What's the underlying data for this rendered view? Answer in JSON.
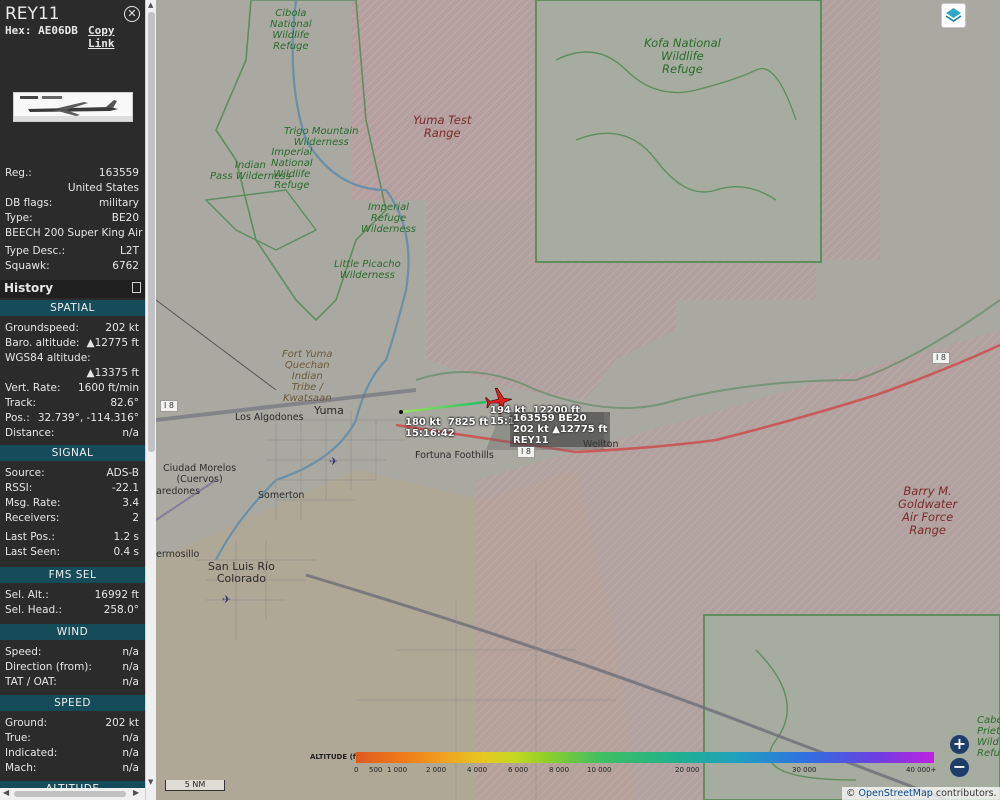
{
  "panel": {
    "callsign": "REY11",
    "hex_line": "Hex: AE06DB",
    "copy_link": "Copy Link",
    "info": [
      {
        "k": "Reg.:",
        "v": "163559"
      },
      {
        "k": "",
        "v": "United States"
      },
      {
        "k": "DB flags:",
        "v": "military"
      },
      {
        "k": "Type:",
        "v": "BE20"
      },
      {
        "k": "BEECH 200 Super King Air",
        "v": ""
      },
      {
        "k": "Type Desc.:",
        "v": "L2T"
      },
      {
        "k": "Squawk:",
        "v": "6762"
      }
    ],
    "history_label": "History",
    "sections": {
      "spatial": "SPATIAL",
      "signal": "SIGNAL",
      "fms": "FMS SEL",
      "wind": "WIND",
      "speed": "SPEED",
      "altitude": "ALTITUDE"
    },
    "spatial": [
      {
        "k": "Groundspeed:",
        "v": "202 kt"
      },
      {
        "k": "Baro. altitude:",
        "v": "▲12775 ft"
      },
      {
        "k": "WGS84 altitude:",
        "v": ""
      },
      {
        "k": "",
        "v": "▲13375 ft"
      },
      {
        "k": "Vert. Rate:",
        "v": "1600 ft/min"
      },
      {
        "k": "Track:",
        "v": "82.6°"
      },
      {
        "k": "Pos.:",
        "v": "32.739°, -114.316°"
      },
      {
        "k": "Distance:",
        "v": "n/a"
      }
    ],
    "signal": [
      {
        "k": "Source:",
        "v": "ADS-B"
      },
      {
        "k": "RSSI:",
        "v": "-22.1"
      },
      {
        "k": "Msg. Rate:",
        "v": "3.4"
      },
      {
        "k": "Receivers:",
        "v": "2"
      },
      {
        "k": "Last Pos.:",
        "v": "1.2 s"
      },
      {
        "k": "Last Seen:",
        "v": "0.4 s"
      }
    ],
    "fms": [
      {
        "k": "Sel. Alt.:",
        "v": "16992 ft"
      },
      {
        "k": "Sel. Head.:",
        "v": "258.0°"
      }
    ],
    "wind": [
      {
        "k": "Speed:",
        "v": "n/a"
      },
      {
        "k": "Direction (from):",
        "v": "n/a"
      },
      {
        "k": "TAT / OAT:",
        "v": "n/a"
      }
    ],
    "speed": [
      {
        "k": "Ground:",
        "v": "202 kt"
      },
      {
        "k": "True:",
        "v": "n/a"
      },
      {
        "k": "Indicated:",
        "v": "n/a"
      },
      {
        "k": "Mach:",
        "v": "n/a"
      }
    ]
  },
  "map": {
    "labels": {
      "cibola": "Cibola\nNational\nWildlife\nRefuge",
      "kofa": "Kofa National\nWildlife\nRefuge",
      "yuma_test": "Yuma Test\nRange",
      "trigo": "Trigo Mountain\nWilderness",
      "imperial_nwr": "Imperial\nNational\nWildlife\nRefuge",
      "indian_pass": "Indian\nPass Wilderness",
      "imperial_refuge": "Imperial\nRefuge\nWilderness",
      "little_picacho": "Little Picacho\nWilderness",
      "fort_yuma": "Fort Yuma\nQuechan\nIndian\nTribe /\nKwatsaan",
      "barry": "Barry M.\nGoldwater\nAir Force\nRange",
      "cabeza": "Cabe\nPrieta N\nWild\nRefu"
    },
    "cities": {
      "yuma": "Yuma",
      "los_algodones": "Los Algodones",
      "fortuna": "Fortuna Foothills",
      "wellton": "Wellton",
      "ciudad_morelos": "Ciudad Morelos\n(Cuervos)",
      "paredones": "aredones",
      "somerton": "Somerton",
      "hermosillo": "ermosillo",
      "san_luis": "San Luis Río\nColorado"
    },
    "shields": [
      "I 8",
      "I 8",
      "I 8"
    ],
    "aircraft": {
      "track_label_1": "180 kt  7825 ft\n15:16:42",
      "track_label_2": "194 kt  12200 ft\n15:1",
      "info_box": "163559 BE20\n202 kt ▲12775 ft\nREY11"
    },
    "scale": "5 NM",
    "attribution_prefix": "© ",
    "attribution_link": "OpenStreetMap",
    "attribution_suffix": " contributors.",
    "legend": {
      "title": "ALTITUDE (ft)",
      "ticks": [
        "0",
        "500",
        "1 000",
        "2 000",
        "4 000",
        "6 000",
        "8 000",
        "10 000",
        "20 000",
        "30 000",
        "40 000+"
      ]
    },
    "colors": {
      "restricted_fill": "#b89a9a",
      "refuge_border": "#5e8e5e",
      "interstate": "#c85a5a",
      "aircraft": "#e02020",
      "track_start": "#20c020",
      "panel_bg": "#2b2b2b",
      "section_bg": "#164b5a"
    }
  }
}
